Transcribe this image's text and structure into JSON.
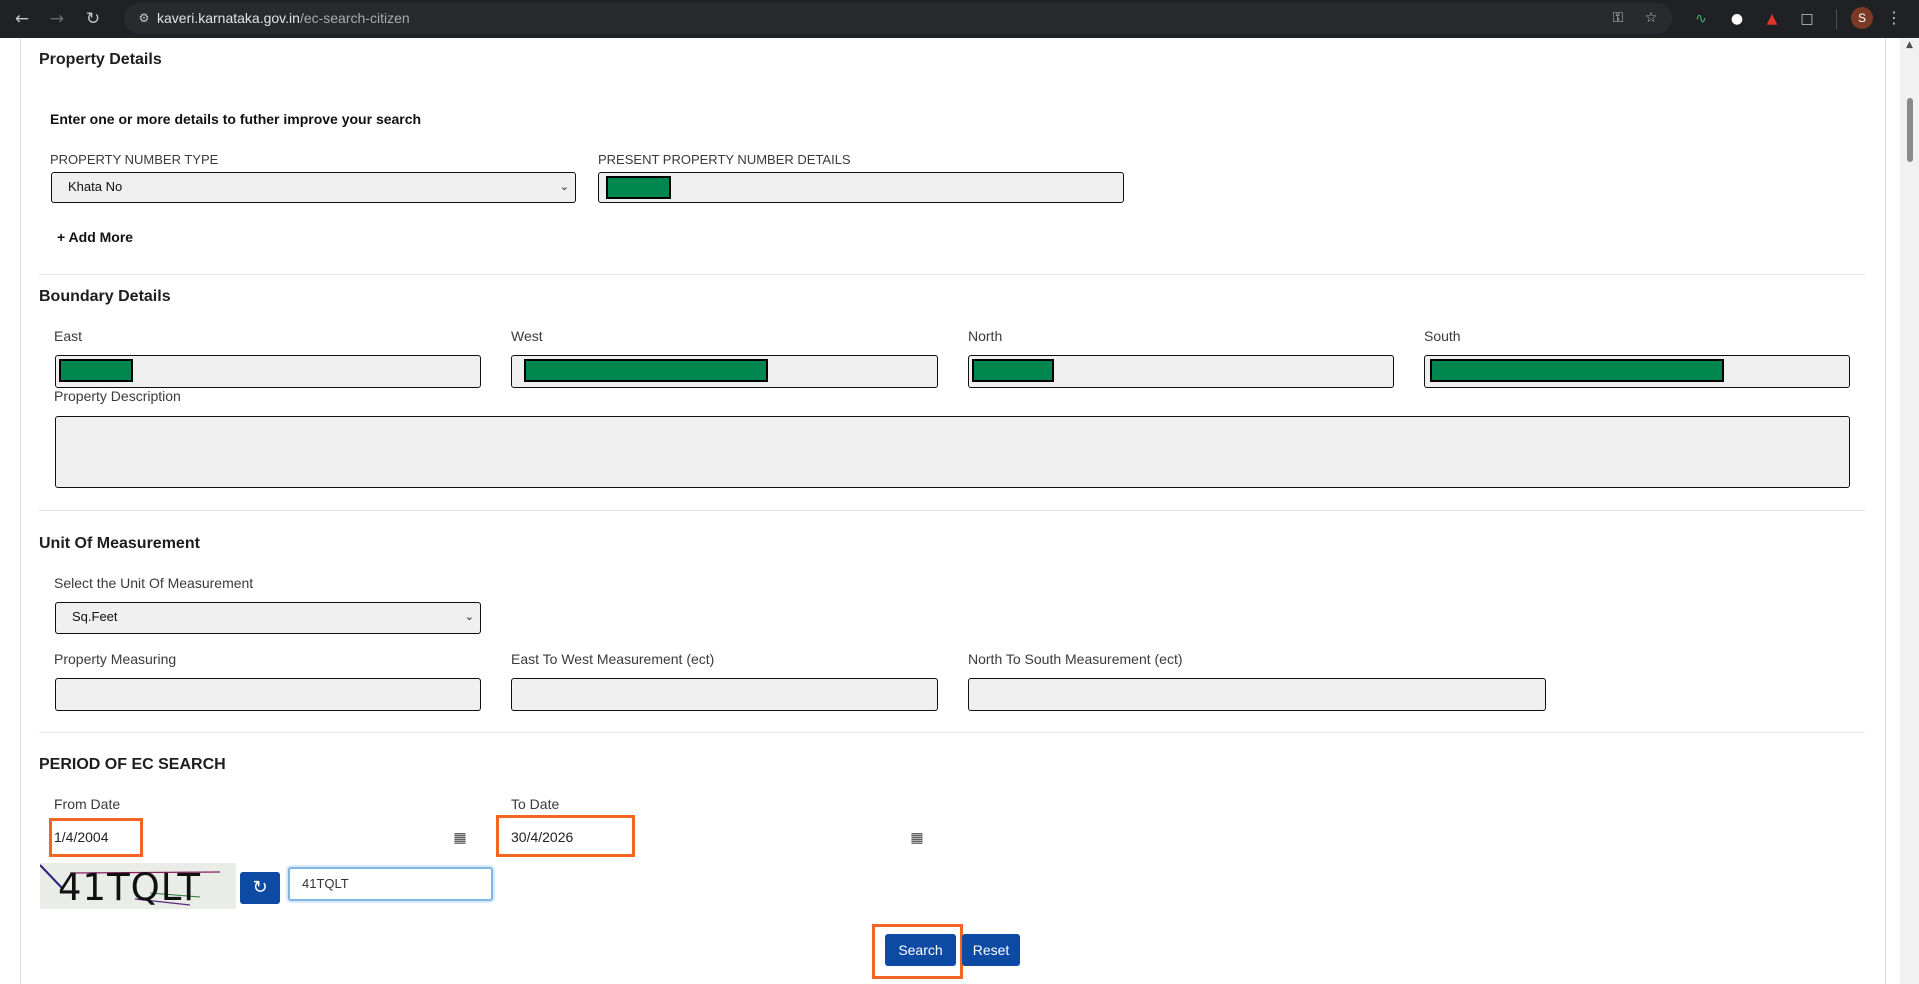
{
  "browser": {
    "url_host": "kaveri.karnataka.gov.in",
    "url_path": "/ec-search-citizen",
    "profile_initial": "S"
  },
  "property_details": {
    "title": "Property Details",
    "hint": "Enter one or more details to futher improve your search",
    "number_type_label": "PROPERTY NUMBER TYPE",
    "number_type_value": "Khata No",
    "present_number_label": "PRESENT PROPERTY NUMBER DETAILS",
    "add_more_label": "+ Add More"
  },
  "boundary_details": {
    "title": "Boundary Details",
    "east_label": "East",
    "west_label": "West",
    "north_label": "North",
    "south_label": "South",
    "description_label": "Property Description"
  },
  "unit_of_measurement": {
    "title": "Unit Of Measurement",
    "select_label": "Select the Unit Of Measurement",
    "select_value": "Sq.Feet",
    "measuring_label": "Property Measuring",
    "east_west_label": "East To West Measurement (ect)",
    "north_south_label": "North To South Measurement (ect)"
  },
  "period": {
    "title": "PERIOD OF EC SEARCH",
    "from_label": "From Date",
    "from_value": "1/4/2004",
    "to_label": "To Date",
    "to_value": "30/4/2026"
  },
  "captcha": {
    "image_text": "41TQLT",
    "input_value": "41TQLT"
  },
  "actions": {
    "search_label": "Search",
    "reset_label": "Reset"
  },
  "colors": {
    "primary_button": "#0d4aa4",
    "highlight": "#f26522",
    "redaction": "#00874f"
  }
}
